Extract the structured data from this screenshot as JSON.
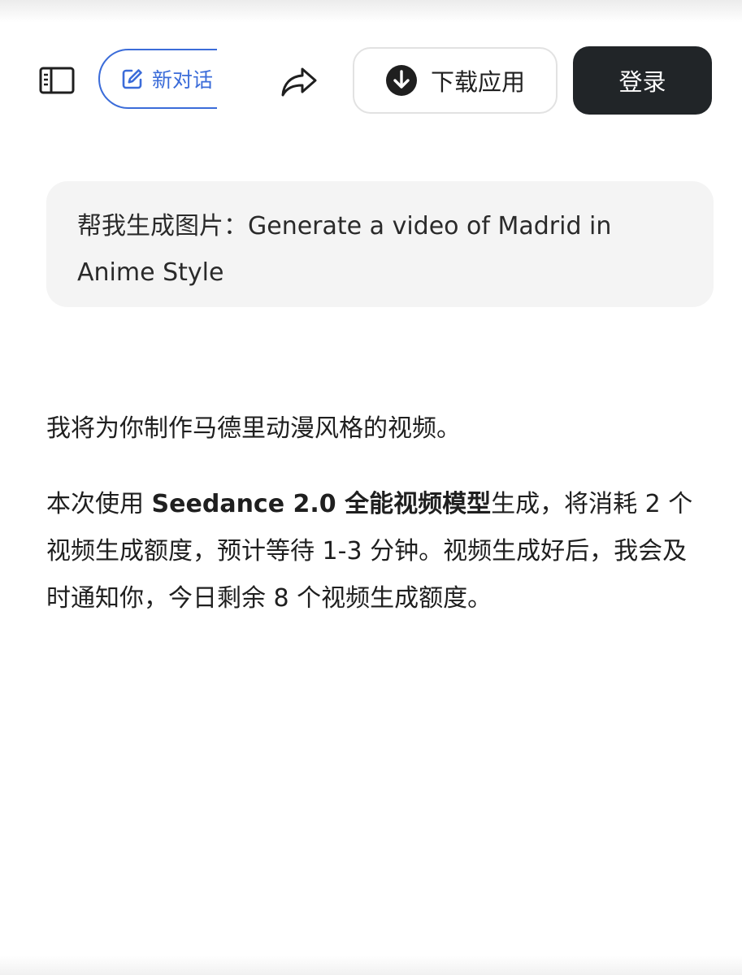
{
  "header": {
    "new_chat_label": "新对话",
    "download_label": "下载应用",
    "login_label": "登录",
    "icons": {
      "sidebar": "sidebar-icon",
      "edit": "edit-icon",
      "share": "share-icon",
      "download": "download-icon"
    },
    "colors": {
      "accent": "#3b6cd9",
      "login_bg": "#212528"
    }
  },
  "conversation": {
    "user_message": "帮我生成图片：Generate a video of Madrid in Anime Style",
    "reply": {
      "intro": "我将为你制作马德里动漫风格的视频。",
      "detail_prefix": "本次使用 ",
      "model_name": "Seedance 2.0 全能视频模型",
      "detail_suffix": "生成，将消耗 2 个视频生成额度，预计等待 1-3 分钟。视频生成好后，我会及时通知你，今日剩余 8 个视频生成额度。"
    }
  }
}
